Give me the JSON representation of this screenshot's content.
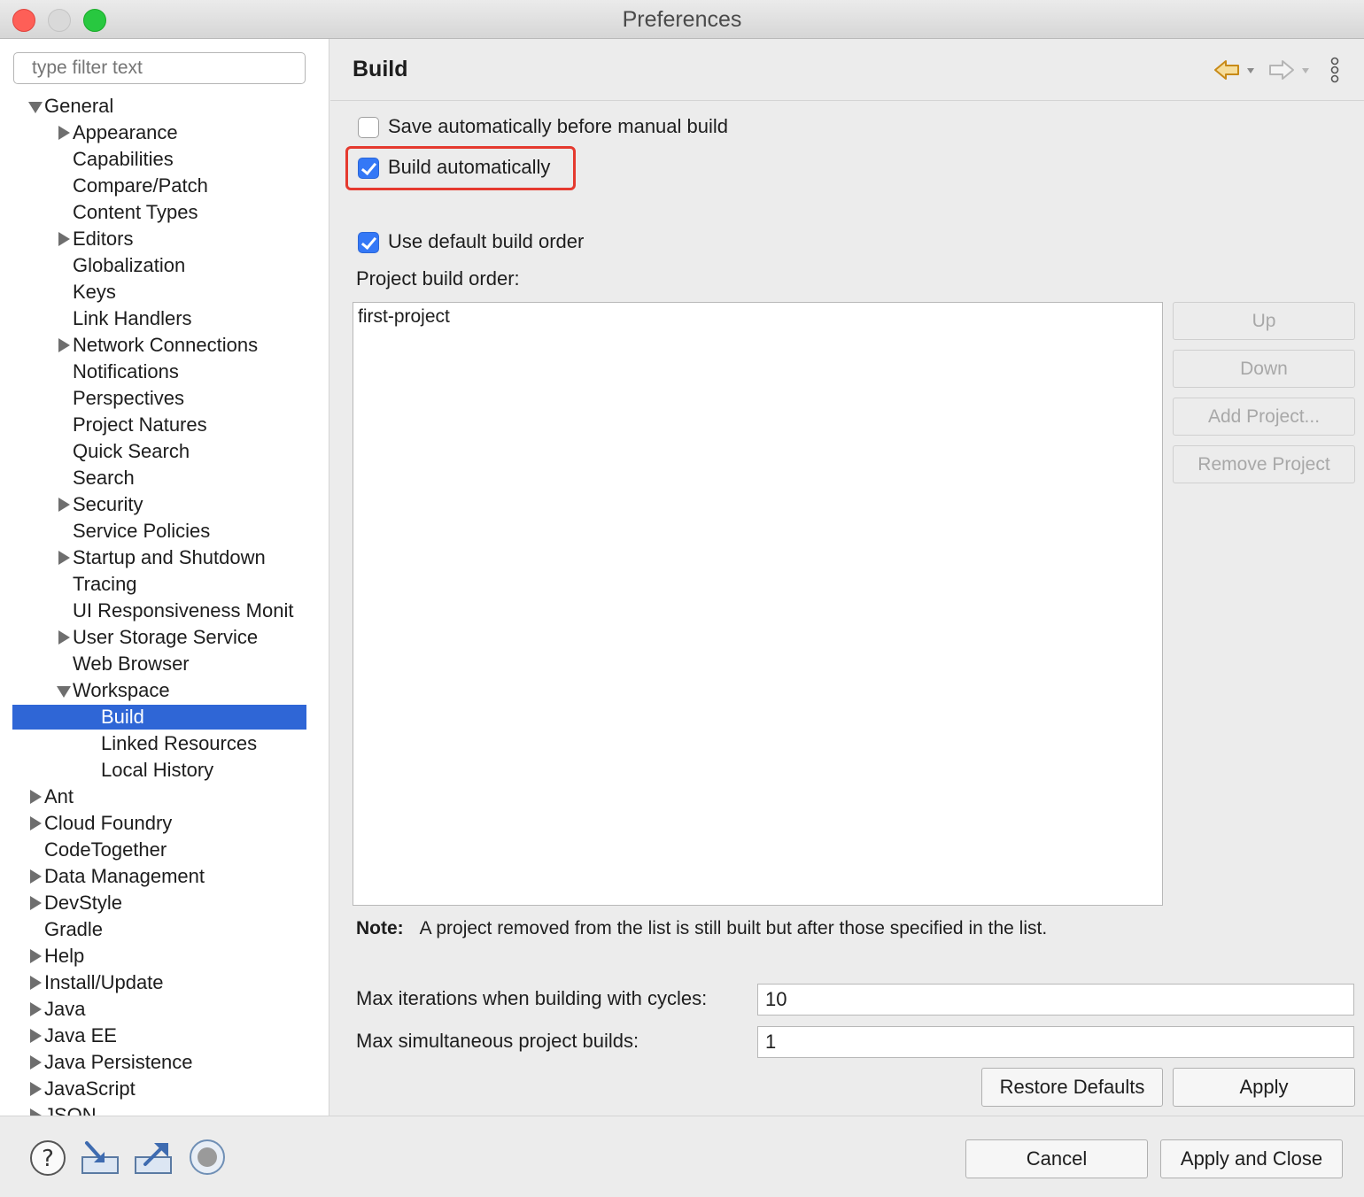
{
  "window": {
    "title": "Preferences"
  },
  "filter": {
    "placeholder": "type filter text"
  },
  "tree": [
    {
      "label": "General",
      "level": 0,
      "toggle": "expanded"
    },
    {
      "label": "Appearance",
      "level": 1,
      "toggle": "collapsed"
    },
    {
      "label": "Capabilities",
      "level": 1,
      "toggle": "none"
    },
    {
      "label": "Compare/Patch",
      "level": 1,
      "toggle": "none"
    },
    {
      "label": "Content Types",
      "level": 1,
      "toggle": "none"
    },
    {
      "label": "Editors",
      "level": 1,
      "toggle": "collapsed"
    },
    {
      "label": "Globalization",
      "level": 1,
      "toggle": "none"
    },
    {
      "label": "Keys",
      "level": 1,
      "toggle": "none"
    },
    {
      "label": "Link Handlers",
      "level": 1,
      "toggle": "none"
    },
    {
      "label": "Network Connections",
      "level": 1,
      "toggle": "collapsed"
    },
    {
      "label": "Notifications",
      "level": 1,
      "toggle": "none"
    },
    {
      "label": "Perspectives",
      "level": 1,
      "toggle": "none"
    },
    {
      "label": "Project Natures",
      "level": 1,
      "toggle": "none"
    },
    {
      "label": "Quick Search",
      "level": 1,
      "toggle": "none"
    },
    {
      "label": "Search",
      "level": 1,
      "toggle": "none"
    },
    {
      "label": "Security",
      "level": 1,
      "toggle": "collapsed"
    },
    {
      "label": "Service Policies",
      "level": 1,
      "toggle": "none"
    },
    {
      "label": "Startup and Shutdown",
      "level": 1,
      "toggle": "collapsed"
    },
    {
      "label": "Tracing",
      "level": 1,
      "toggle": "none"
    },
    {
      "label": "UI Responsiveness Monit",
      "level": 1,
      "toggle": "none"
    },
    {
      "label": "User Storage Service",
      "level": 1,
      "toggle": "collapsed"
    },
    {
      "label": "Web Browser",
      "level": 1,
      "toggle": "none"
    },
    {
      "label": "Workspace",
      "level": 1,
      "toggle": "expanded"
    },
    {
      "label": "Build",
      "level": 2,
      "toggle": "none",
      "selected": true
    },
    {
      "label": "Linked Resources",
      "level": 2,
      "toggle": "none"
    },
    {
      "label": "Local History",
      "level": 2,
      "toggle": "none"
    },
    {
      "label": "Ant",
      "level": 0,
      "toggle": "collapsed"
    },
    {
      "label": "Cloud Foundry",
      "level": 0,
      "toggle": "collapsed"
    },
    {
      "label": "CodeTogether",
      "level": 0,
      "toggle": "none"
    },
    {
      "label": "Data Management",
      "level": 0,
      "toggle": "collapsed"
    },
    {
      "label": "DevStyle",
      "level": 0,
      "toggle": "collapsed"
    },
    {
      "label": "Gradle",
      "level": 0,
      "toggle": "none"
    },
    {
      "label": "Help",
      "level": 0,
      "toggle": "collapsed"
    },
    {
      "label": "Install/Update",
      "level": 0,
      "toggle": "collapsed"
    },
    {
      "label": "Java",
      "level": 0,
      "toggle": "collapsed"
    },
    {
      "label": "Java EE",
      "level": 0,
      "toggle": "collapsed"
    },
    {
      "label": "Java Persistence",
      "level": 0,
      "toggle": "collapsed"
    },
    {
      "label": "JavaScript",
      "level": 0,
      "toggle": "collapsed"
    },
    {
      "label": "JSON",
      "level": 0,
      "toggle": "collapsed"
    }
  ],
  "page": {
    "title": "Build",
    "save_before_build": {
      "label": "Save automatically before manual build",
      "checked": false
    },
    "build_automatically": {
      "label": "Build automatically",
      "checked": true
    },
    "use_default_order": {
      "label": "Use default build order",
      "checked": true
    },
    "build_order_label": "Project build order:",
    "build_order_items": [
      "first-project"
    ],
    "side_buttons": {
      "up": "Up",
      "down": "Down",
      "add": "Add Project...",
      "remove": "Remove Project"
    },
    "note_label": "Note:",
    "note_text": "A project removed from the list is still built but after those specified in the list.",
    "max_iterations_label": "Max iterations when building with cycles:",
    "max_iterations_value": "10",
    "max_builds_label": "Max simultaneous project builds:",
    "max_builds_value": "1",
    "restore_defaults": "Restore Defaults",
    "apply": "Apply"
  },
  "footer": {
    "cancel": "Cancel",
    "apply_close": "Apply and Close"
  },
  "colors": {
    "selection": "#2f66d6",
    "checkbox": "#3478f6",
    "highlight": "#e53a2f"
  },
  "icons": [
    "back-arrow-icon",
    "forward-arrow-icon",
    "view-menu-icon",
    "help-icon",
    "import-icon",
    "export-icon",
    "record-icon"
  ]
}
